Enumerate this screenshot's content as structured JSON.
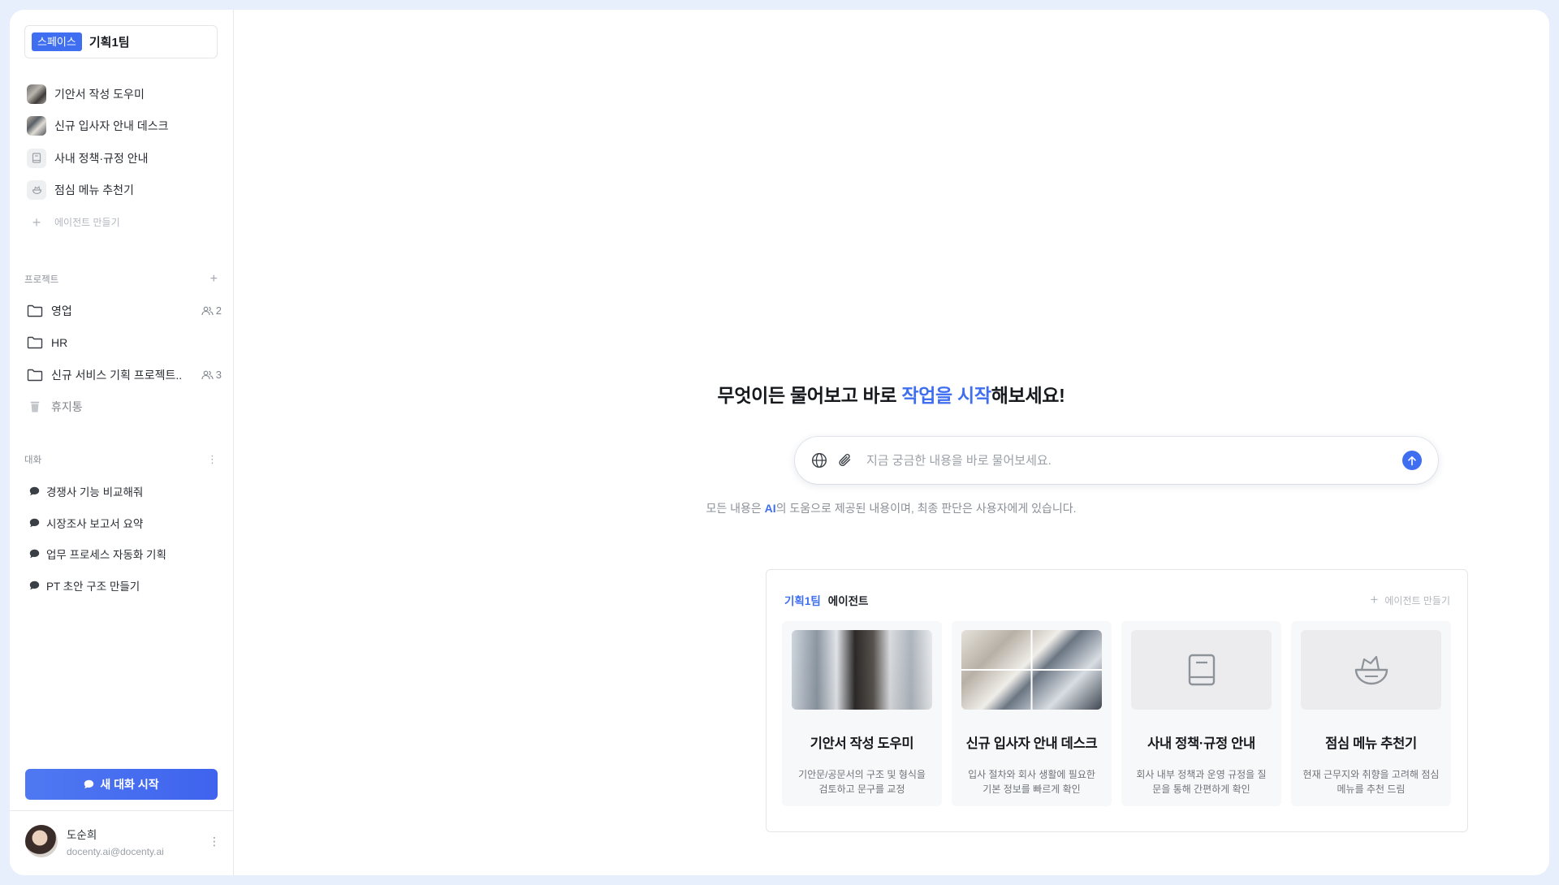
{
  "sidebar": {
    "space_badge": "스페이스",
    "space_name": "기획1팀",
    "agents": [
      {
        "label": "기안서 작성 도우미",
        "icon": "photo-thumbnail"
      },
      {
        "label": "신규 입사자 안내 데스크",
        "icon": "photo-thumbnail"
      },
      {
        "label": "사내 정책·규정 안내",
        "icon": "book-icon"
      },
      {
        "label": "점심 메뉴 추천기",
        "icon": "bowl-icon"
      }
    ],
    "create_agent_label": "에이전트 만들기",
    "projects_heading": "프로젝트",
    "projects": [
      {
        "label": "영업",
        "members": "2"
      },
      {
        "label": "HR",
        "members": ""
      },
      {
        "label": "신규 서비스 기획 프로젝트..",
        "members": "3"
      }
    ],
    "trash_label": "휴지통",
    "conversations_heading": "대화",
    "conversations": [
      {
        "label": "경쟁사 기능 비교해줘"
      },
      {
        "label": "시장조사 보고서 요약"
      },
      {
        "label": "업무 프로세스 자동화 기획"
      },
      {
        "label": "PT 초안 구조 만들기"
      }
    ],
    "new_chat_label": "새 대화 시작",
    "user": {
      "name": "도순희",
      "email": "docenty.ai@docenty.ai"
    }
  },
  "main": {
    "hero": {
      "prefix": "무엇이든 물어보고 바로 ",
      "accent": "작업을 시작",
      "suffix": "해보세요!"
    },
    "search": {
      "placeholder": "지금 궁금한 내용을 바로 물어보세요.",
      "value": ""
    },
    "disclaimer": {
      "prefix": "모든 내용은 ",
      "ai": "AI",
      "suffix": "의 도움으로 제공된 내용이며, 최종 판단은 사용자에게 있습니다."
    },
    "panel": {
      "space": "기획1팀",
      "title": "에이전트",
      "add_label": "에이전트 만들기",
      "cards": [
        {
          "title": "기안서 작성 도우미",
          "desc": "기안문/공문서의 구조 및 형식을 검토하고 문구를 교정",
          "image": "photo"
        },
        {
          "title": "신규 입사자 안내 데스크",
          "desc": "입사 절차와 회사 생활에 필요한 기본 정보를 빠르게 확인",
          "image": "photo"
        },
        {
          "title": "사내 정책·규정 안내",
          "desc": "회사 내부 정책과 운영 규정을 질문을 통해 간편하게 확인",
          "image": "book-icon"
        },
        {
          "title": "점심 메뉴 추천기",
          "desc": "현재 근무지와 취향을 고려해 점심 메뉴를 추천 드림",
          "image": "bowl-icon"
        }
      ]
    }
  },
  "colors": {
    "accent": "#3f6ff0",
    "page_bg": "#e8effc"
  }
}
